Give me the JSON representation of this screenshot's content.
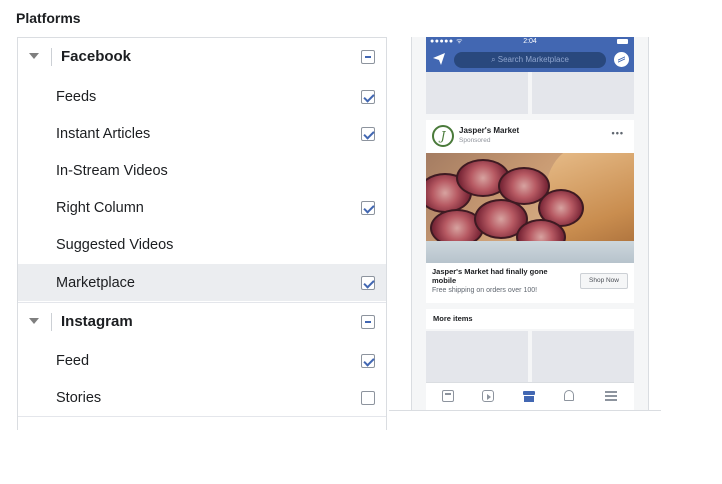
{
  "section_title": "Platforms",
  "placements": {
    "facebook": {
      "label": "Facebook",
      "state": "partial",
      "items": [
        {
          "label": "Feeds",
          "checked": true
        },
        {
          "label": "Instant Articles",
          "checked": true
        },
        {
          "label": "In-Stream Videos",
          "checked": null
        },
        {
          "label": "Right Column",
          "checked": true
        },
        {
          "label": "Suggested Videos",
          "checked": null
        },
        {
          "label": "Marketplace",
          "checked": true,
          "selected": true
        }
      ]
    },
    "instagram": {
      "label": "Instagram",
      "state": "partial",
      "items": [
        {
          "label": "Feed",
          "checked": true
        },
        {
          "label": "Stories",
          "checked": false
        }
      ]
    }
  },
  "preview": {
    "status_time": "2:04",
    "status_signal": "●●●●● ᯤ",
    "search_placeholder": "Search Marketplace",
    "ad": {
      "advertiser": "Jasper's Market",
      "avatar_letter": "J",
      "sponsored_label": "Sponsored",
      "menu_glyph": "•••",
      "headline": "Jasper's Market had finally gone mobile",
      "description": "Free shipping on orders over 100!",
      "cta": "Shop Now"
    },
    "more_items_label": "More items",
    "tabs": [
      "feed-icon",
      "video-icon",
      "marketplace-icon",
      "notifications-icon",
      "menu-icon"
    ]
  },
  "colors": {
    "accent": "#4267b2",
    "selected_row": "#ebedf0",
    "border": "#dadde1"
  }
}
